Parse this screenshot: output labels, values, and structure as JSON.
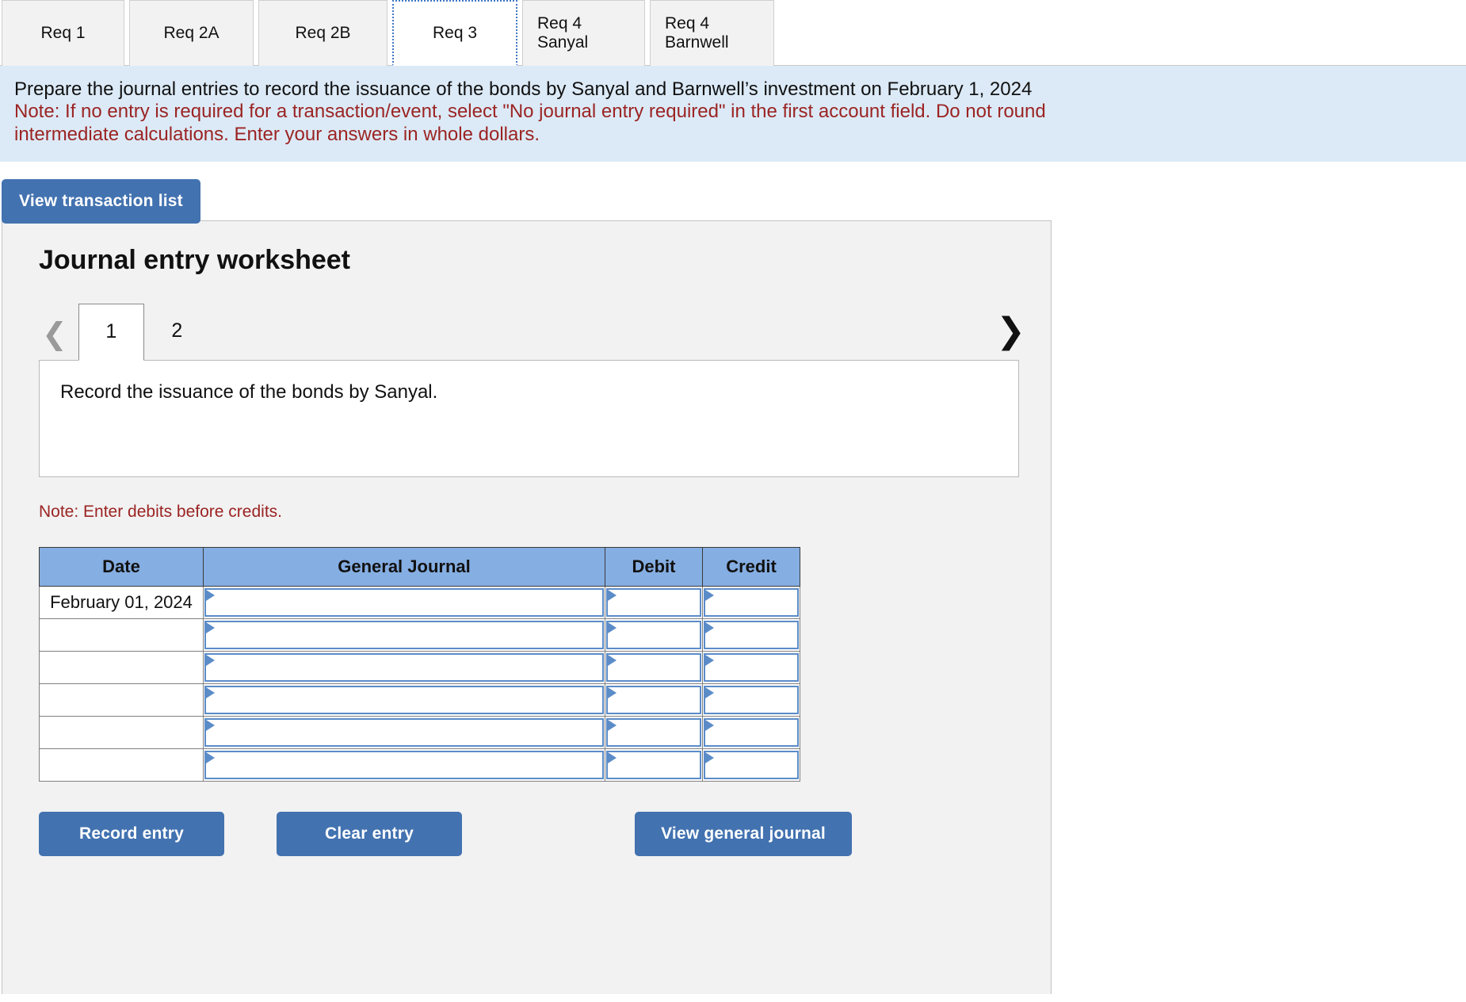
{
  "req_tabs": [
    {
      "label": "Req 1",
      "active": false
    },
    {
      "label": "Req 2A",
      "active": false
    },
    {
      "label": "Req 2B",
      "active": false
    },
    {
      "label": "Req 3",
      "active": true
    },
    {
      "label": "Req 4 Sanyal",
      "active": false
    },
    {
      "label": "Req 4 Barnwell",
      "active": false
    }
  ],
  "instruction": {
    "prompt": "Prepare the journal entries to record the issuance of the bonds by Sanyal and Barnwell’s investment on February 1, 2024",
    "note_line_1": "Note: If no entry is required for a transaction/event, select \"No journal entry required\" in the first account field. Do not round",
    "note_line_2": "intermediate calculations. Enter your answers in whole dollars."
  },
  "toolbar": {
    "view_transaction_list_label": "View transaction list"
  },
  "worksheet": {
    "title": "Journal entry worksheet",
    "prev_icon": "chevron-left-icon",
    "next_icon": "chevron-right-icon",
    "page_tabs": [
      {
        "label": "1",
        "active": true
      },
      {
        "label": "2",
        "active": false
      }
    ],
    "transaction_description": "Record the issuance of the bonds by Sanyal.",
    "debits_note": "Note: Enter debits before credits.",
    "table": {
      "columns": [
        "Date",
        "General Journal",
        "Debit",
        "Credit"
      ],
      "rows": [
        {
          "date": "February 01, 2024",
          "general_journal": "",
          "debit": "",
          "credit": ""
        },
        {
          "date": "",
          "general_journal": "",
          "debit": "",
          "credit": ""
        },
        {
          "date": "",
          "general_journal": "",
          "debit": "",
          "credit": ""
        },
        {
          "date": "",
          "general_journal": "",
          "debit": "",
          "credit": ""
        },
        {
          "date": "",
          "general_journal": "",
          "debit": "",
          "credit": ""
        },
        {
          "date": "",
          "general_journal": "",
          "debit": "",
          "credit": ""
        }
      ]
    },
    "actions": {
      "record_entry_label": "Record entry",
      "clear_entry_label": "Clear entry",
      "view_general_journal_label": "View general journal"
    }
  },
  "colors": {
    "button_blue": "#4272b0",
    "table_header_blue": "#85aee2",
    "banner_blue": "#dceaf7",
    "note_red": "#9b2423",
    "input_border_blue": "#5b8cc8"
  }
}
